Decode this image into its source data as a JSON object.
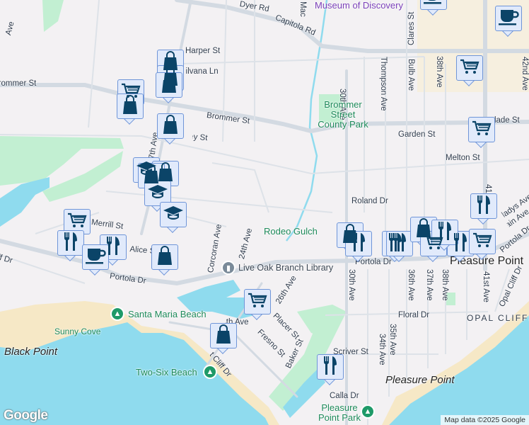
{
  "streets": {
    "harper": "Harper St",
    "silvana": "Silvana Ln",
    "brommer_w": "Brommer St",
    "brommer": "Brommer St",
    "capitola": "Capitola Rd",
    "dyer": "Dyer Rd",
    "mac": "Mac",
    "ave_nw": "Ave",
    "ave_30_n": "30th Ave",
    "thompson": "Thompson Ave",
    "bulb": "Bulb Ave",
    "clares": "Clares St",
    "ave_38_n": "38th Ave",
    "ave_42": "42nd Ave",
    "garden": "Garden St",
    "melton": "Melton St",
    "glade": "Glade St",
    "roland": "Roland Dr",
    "ave_41": "41st Ave",
    "gladys": "Gladys Ave",
    "main": "Main Ave",
    "portola_e": "Portola Dr",
    "portola_c": "Portola Dr",
    "portola_w": "Portola Dr",
    "ave_17": "17th Ave",
    "frey": "Frey St",
    "merrill": "Merrill St",
    "alice": "Alice St",
    "cliff_w": "East Cliff Dr",
    "corcoran": "Corcoran Ave",
    "ave_24": "24th Ave",
    "ave_26": "26th Ave",
    "placer": "Placer St",
    "fresno": "Fresno St",
    "baker": "Baker St",
    "ave_30_s": "30th Ave",
    "ave_34": "34th Ave",
    "ave_35": "35th Ave",
    "ave_36": "36th Ave",
    "ave_37": "37th Ave",
    "ave_38_s": "38th Ave",
    "ave_41_s": "41st Ave",
    "floral": "Floral Dr",
    "scriver": "Scriver St",
    "calla": "Calla Dr",
    "opal_cliff": "Opal Cliff Dr",
    "ave_25": "25th Ave",
    "cliff_s": "East Cliff Dr"
  },
  "places": {
    "brommer_park": "Brommer Street County Park",
    "rodeo_gulch": "Rodeo Gulch",
    "library": "Live Oak Branch Library",
    "santa_maria": "Santa Maria Beach",
    "sunny_cove": "Sunny Cove",
    "black_point": "Black Point",
    "two_six": "Two-Six Beach",
    "pleasure_point_town": "Pleasure Point",
    "pleasure_point_area": "Pleasure Point",
    "pleasure_point_park": "Pleasure Point Park",
    "opal_cliffs": "OPAL CLIFFS",
    "museum": "Museum of Discovery"
  },
  "markers": [
    "cup",
    "cup",
    "cart",
    "cart",
    "bag",
    "bag",
    "bag",
    "cart",
    "bag",
    "bag",
    "cap",
    "bag",
    "bag",
    "cap",
    "cap",
    "cart",
    "fork",
    "fork",
    "cup",
    "bag",
    "cart",
    "bag",
    "bag",
    "fork",
    "fork",
    "fork",
    "fork",
    "bag",
    "cart",
    "fork",
    "cart",
    "fork",
    "fork"
  ],
  "colors": {
    "marker_icon": "#0b4468",
    "water": "#8fdbee",
    "park": "#c2efd2",
    "beach": "#f6e8c6",
    "commercial": "#f6efdf"
  },
  "attribution": "Map data ©2025 Google",
  "logo": "Google"
}
